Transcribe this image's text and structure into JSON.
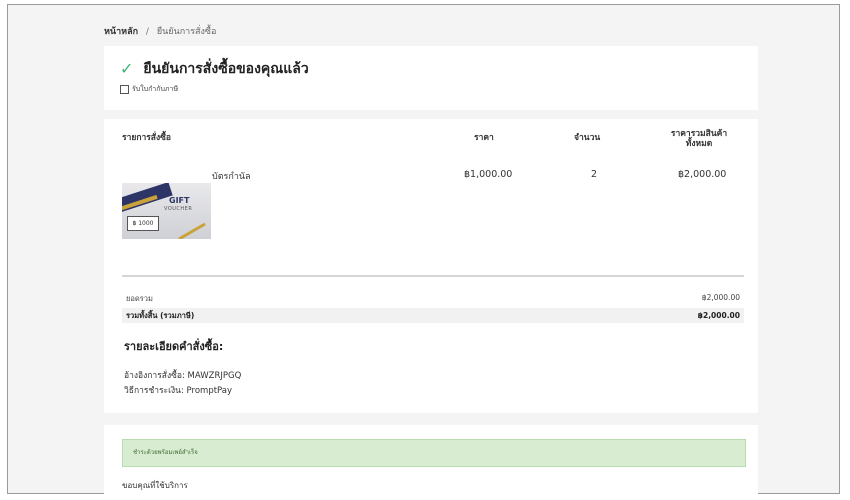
{
  "breadcrumb": {
    "home": "หน้าหลัก",
    "separator": "/",
    "current": "ยืนยันการสั่งซื้อ"
  },
  "confirmation": {
    "title": "ยืนยันการสั่งซื้อของคุณแล้ว",
    "tax_invoice_label": "รับใบกำกับภาษี"
  },
  "order_table": {
    "headers": {
      "items": "รายการสั่งซื้อ",
      "price": "ราคา",
      "quantity": "จำนวน",
      "total": "ราคารวมสินค้าทั้งหมด"
    },
    "rows": [
      {
        "name": "บัตรกำนัล",
        "price": "฿1,000.00",
        "quantity": "2",
        "total": "฿2,000.00",
        "image_text": {
          "gift": "GIFT",
          "voucher": "VOUCHER",
          "amount": "฿ 1000"
        }
      }
    ],
    "subtotal_label": "ยอดรวม",
    "subtotal_value": "฿2,000.00",
    "grand_total_label": "รวมทั้งสิ้น (รวมภาษี)",
    "grand_total_value": "฿2,000.00"
  },
  "details": {
    "title": "รายละเอียดคำสั่งซื้อ:",
    "reference": "อ้างอิงการสั่งซื้อ: MAWZRJPGQ",
    "payment_method": "วิธีการชำระเงิน: PromptPay"
  },
  "payment_status": {
    "message": "ชำระด้วยพร้อมเพย์สำเร็จ",
    "thanks": "ขอบคุณที่ใช้บริการ"
  },
  "colors": {
    "accent_check": "#3cb371",
    "success_bg": "#d8ecd2"
  },
  "icons": {
    "check": "check-icon"
  }
}
